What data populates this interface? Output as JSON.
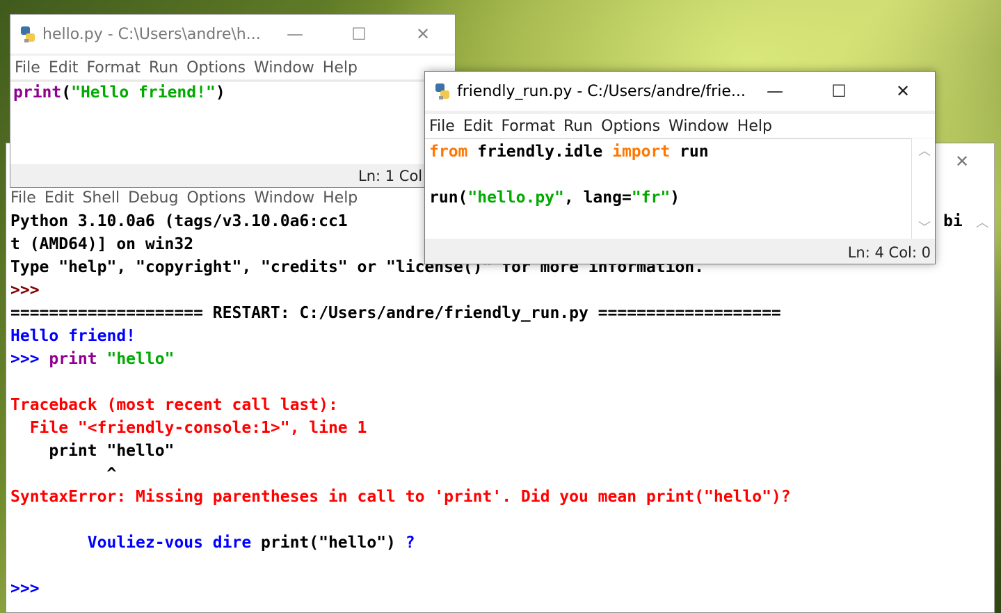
{
  "colors": {
    "keyword": "#ff7700",
    "string": "#00aa00",
    "builtin": "#900090",
    "output": "#0000ff",
    "error": "#ff0000",
    "prompt": "#800000"
  },
  "hello_window": {
    "title": "hello.py - C:\\Users\\andre\\h...",
    "menu": [
      "File",
      "Edit",
      "Format",
      "Run",
      "Options",
      "Window",
      "Help"
    ],
    "code": {
      "func": "print",
      "open": "(",
      "string": "\"Hello friend!\"",
      "close": ")"
    },
    "status": "Ln: 1  Col"
  },
  "friendly_window": {
    "title": "friendly_run.py - C:/Users/andre/frie...",
    "menu": [
      "File",
      "Edit",
      "Format",
      "Run",
      "Options",
      "Window",
      "Help"
    ],
    "code": {
      "line1": {
        "kw1": "from",
        "module": " friendly.idle ",
        "kw2": "import",
        "name": " run"
      },
      "line3": {
        "func": "run(",
        "arg1": "\"hello.py\"",
        "mid": ", lang=",
        "arg2": "\"fr\"",
        "close": ")"
      }
    },
    "status": "Ln: 4  Col: 0"
  },
  "shell_window": {
    "menu": [
      "File",
      "Edit",
      "Shell",
      "Debug",
      "Options",
      "Window",
      "Help"
    ],
    "lines": {
      "banner1": "Python 3.10.0a6 (tags/v3.10.0a6:cc1",
      "banner1_end": "bi",
      "banner2": "t (AMD64)] on win32",
      "banner3": "Type \"help\", \"copyright\", \"credits\" or \"license()\" for more information.",
      "prompt1": ">>>",
      "restart": "==================== RESTART: C:/Users/andre/friendly_run.py ===================",
      "output1": "Hello friend!",
      "prompt2": ">>> ",
      "input_func": "print",
      "input_str": " \"hello\"",
      "traceback": "Traceback (most recent call last):",
      "file_line": "  File \"<friendly-console:1>\", line 1",
      "src_line": "    print \"hello\"",
      "caret": "          ^",
      "syntax_error": "SyntaxError: Missing parentheses in call to 'print'. Did you mean print(\"hello\")?",
      "hint_a": "        Vouliez-vous dire ",
      "hint_b": "print(\"hello\")",
      "hint_c": " ?",
      "prompt3": ">>>"
    }
  }
}
